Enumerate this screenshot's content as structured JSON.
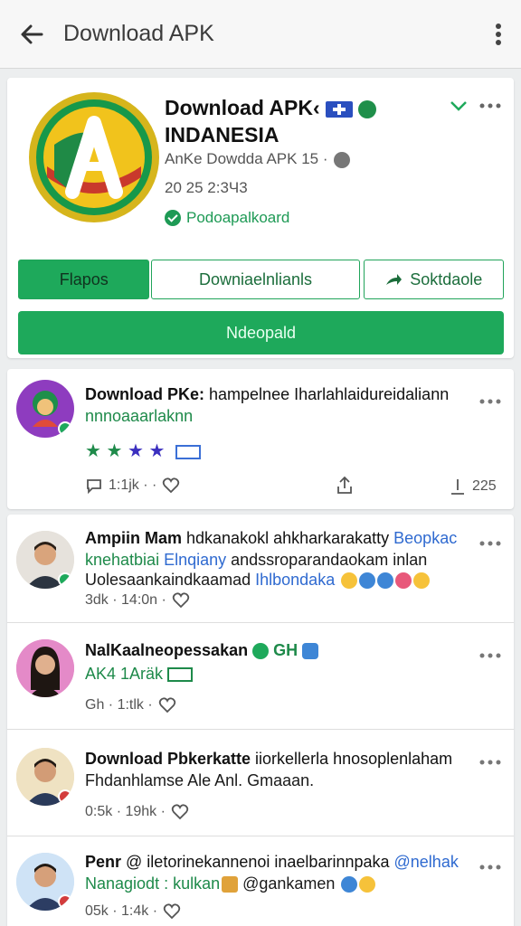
{
  "appbar": {
    "title": "Download APK"
  },
  "hero": {
    "title_line1": "Download APK‹",
    "title_line2": "INDANESIA",
    "subtitle": "AnKe Dowdda APK 15 ·",
    "date": "20 25 2:3Ч3",
    "status": "Podoapalkoard",
    "buttons": {
      "primary": "Flapos",
      "secondary": "Downiaelnlianls",
      "share": "Soktdaole"
    },
    "main_button": "Ndeopald"
  },
  "post": {
    "title_bold": "Download PKe:",
    "title_rest": " hampelnee Iharlahlaidureidaliann",
    "subtitle": "nnnoaaarlaknn",
    "tags": "★",
    "likes": "1:1jk · ·",
    "shares": "225",
    "colors": {
      "accent": "#1ea95b",
      "tag": "#3b2fbf"
    }
  },
  "feed": [
    {
      "name": "Ampiin Mam",
      "rest": " hdkanakokl ahkharkarakatty",
      "tag": " Beopkac",
      "line2_a": "knehatbiai",
      "line2_b": " Elnqiany",
      "line2_c": " andssroparandaokam inlan",
      "line3_a": "Uolesaankaindkaamad",
      "line3_b": " Ihlbondaka",
      "meta": "3dk · 14:0n ·"
    },
    {
      "name": "NalKaalneopessakan",
      "tag": " GH",
      "line2": "AK4 1Aräk",
      "meta": "Gһ ·  1:tlk ·"
    },
    {
      "name": "Download Pbkerkatte",
      "rest": " iiorkellerla hnosoplenlaham",
      "line2": "Fhdanhlamse Ale Anl. Gmaaan.",
      "meta": "0:5k ·  19hk ·"
    },
    {
      "name": "Penr",
      "rest": " @ iletorinekannenoi inaelbarinnpaka",
      "tag": " @nelhak",
      "line2_a": "Nanagiodt : kulkan",
      "line2_b": " @gankamen",
      "meta": "05k ·  1:4k ·"
    }
  ]
}
